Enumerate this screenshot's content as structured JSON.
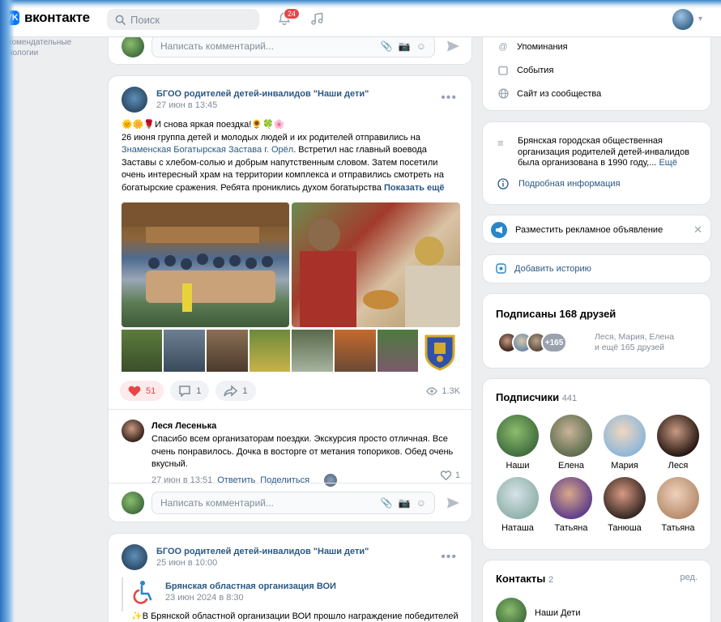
{
  "header": {
    "logo_text": "вконтакте",
    "search_placeholder": "Поиск",
    "notifications_count": "24"
  },
  "left_menu": {
    "line1": "комендательные",
    "line2": "нологии"
  },
  "comment_input": {
    "placeholder": "Написать комментарий..."
  },
  "post1": {
    "group_name": "БГОО родителей детей-инвалидов \"Наши дети\"",
    "date": "27 июн в 13:45",
    "emoji_line": "🌞🌼🌹И снова яркая поездка!🌻🍀🌸",
    "text_a": "26 июня группа детей и молодых людей и их родителей отправились на ",
    "link": "Знаменская Богатырская Застава г. Орёл",
    "text_b": ". Встретил нас главный воевода Заставы с хлебом-солью и добрым напутственным словом. Затем посетили очень интересный храм на территории комплекса и отправились смотреть на богатырские сражения. Ребята прониклись духом богатырства ",
    "show_more": "Показать ещё",
    "likes": "51",
    "comments": "1",
    "shares": "1",
    "views": "1.3K"
  },
  "comment": {
    "author": "Леся Лесенька",
    "text": "Спасибо всем организаторам поездки. Экскурсия просто отличная. Все очень понравилось. Дочка в восторге от метания топориков. Обед очень вкусный.",
    "date": "27 июн в 13:51",
    "reply": "Ответить",
    "share": "Поделиться",
    "likes": "1"
  },
  "post2": {
    "group_name": "БГОО родителей детей-инвалидов \"Наши дети\"",
    "date": "25 июн в 10:00",
    "repost_name": "Брянская областная организация ВОИ",
    "repost_date": "23 июн 2024 в 8:30",
    "text": "✨В Брянской областной организации ВОИ прошло награждение победителей"
  },
  "right": {
    "menu": [
      {
        "label": "Упоминания",
        "icon": "at-icon"
      },
      {
        "label": "События",
        "icon": "calendar-icon"
      },
      {
        "label": "Сайт из сообщества",
        "icon": "globe-icon"
      }
    ],
    "about_text": "Брянская городская общественная организация родителей детей-инвалидов была организована в 1990 году,...",
    "about_more": "Ещё",
    "details": "Подробная информация",
    "ad": "Разместить рекламное объявление",
    "story": "Добавить историю",
    "friends_title": "Подписаны 168 друзей",
    "friends_more": "+165",
    "friends_names": "Леся, Мария, Елена",
    "friends_rest": "и ещё 165 друзей",
    "subs_title": "Подписчики",
    "subs_count": "441",
    "subscribers": [
      "Наши",
      "Елена",
      "Мария",
      "Леся",
      "Наташа",
      "Татьяна",
      "Танюша",
      "Татьяна"
    ],
    "contacts_title": "Контакты",
    "contacts_count": "2",
    "contacts_edit": "ред.",
    "contact_name": "Наши Дети"
  },
  "colors": {
    "accent": "#2a5885",
    "brand": "#0077ff",
    "like": "#e64646"
  }
}
